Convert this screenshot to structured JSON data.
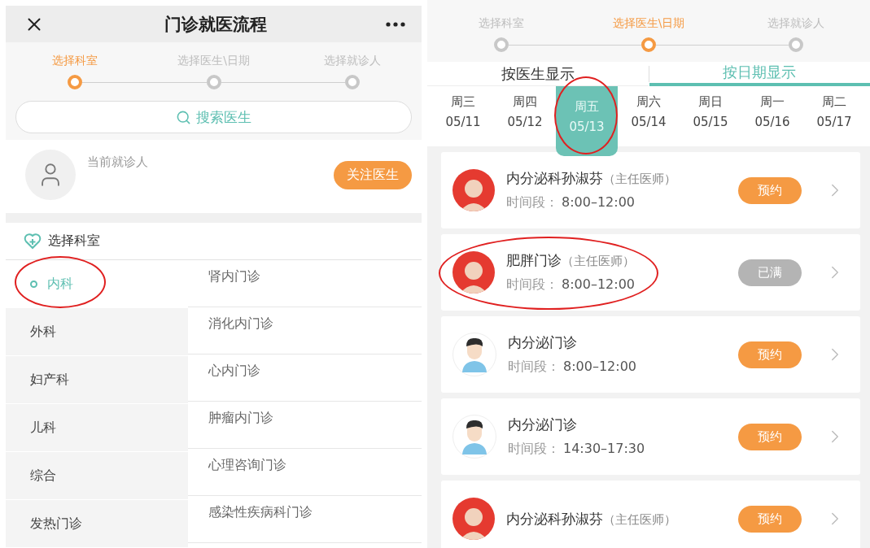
{
  "left": {
    "header": {
      "title": "门诊就医流程"
    },
    "steps": [
      {
        "label": "选择科室",
        "selected": true
      },
      {
        "label": "选择医生\\日期",
        "selected": false
      },
      {
        "label": "选择就诊人",
        "selected": false
      }
    ],
    "search": {
      "placeholder": "搜索医生"
    },
    "patient": {
      "label": "当前就诊人",
      "button": "关注医生"
    },
    "section_title": "选择科室",
    "departments": [
      {
        "label": "内科",
        "selected": true,
        "circled": true
      },
      {
        "label": "外科",
        "selected": false,
        "circled": false
      },
      {
        "label": "妇产科",
        "selected": false,
        "circled": false
      },
      {
        "label": "儿科",
        "selected": false,
        "circled": false
      },
      {
        "label": "综合",
        "selected": false,
        "circled": false
      },
      {
        "label": "发热门诊",
        "selected": false,
        "circled": false
      }
    ],
    "sub_departments": [
      "肾内门诊",
      "消化内门诊",
      "心内门诊",
      "肿瘤内门诊",
      "心理咨询门诊",
      "感染性疾病科门诊"
    ]
  },
  "right": {
    "steps": [
      {
        "label": "选择科室",
        "selected": false
      },
      {
        "label": "选择医生\\日期",
        "selected": true
      },
      {
        "label": "选择就诊人",
        "selected": false
      }
    ],
    "view_tabs": [
      {
        "label": "按医生显示",
        "selected": false
      },
      {
        "label": "按日期显示",
        "selected": true
      }
    ],
    "dates": [
      {
        "weekday": "周三",
        "date": "05/11",
        "selected": false,
        "circled": false
      },
      {
        "weekday": "周四",
        "date": "05/12",
        "selected": false,
        "circled": false
      },
      {
        "weekday": "周五",
        "date": "05/13",
        "selected": true,
        "circled": true
      },
      {
        "weekday": "周六",
        "date": "05/14",
        "selected": false,
        "circled": false
      },
      {
        "weekday": "周日",
        "date": "05/15",
        "selected": false,
        "circled": false
      },
      {
        "weekday": "周一",
        "date": "05/16",
        "selected": false,
        "circled": false
      },
      {
        "weekday": "周二",
        "date": "05/17",
        "selected": false,
        "circled": false
      }
    ],
    "doctors": [
      {
        "name": "内分泌科孙淑芬",
        "title": "（主任医师）",
        "time_label": "时间段：",
        "time": "8:00–12:00",
        "kind": "photo",
        "button": "预约",
        "full": false,
        "circled": false
      },
      {
        "name": "肥胖门诊",
        "title": "（主任医师）",
        "time_label": "时间段：",
        "time": "8:00–12:00",
        "kind": "photo",
        "button": "已满",
        "full": true,
        "circled": true
      },
      {
        "name": "内分泌门诊",
        "time_label": "时间段：",
        "time": "8:00–12:00",
        "kind": "cartoon",
        "button": "预约",
        "full": false,
        "circled": false
      },
      {
        "name": "内分泌门诊",
        "time_label": "时间段：",
        "time": "14:30–17:30",
        "kind": "cartoon",
        "button": "预约",
        "full": false,
        "circled": false
      },
      {
        "name": "内分泌科孙淑芬",
        "title": "（主任医师）",
        "kind": "photo",
        "button": "预约",
        "full": false,
        "circled": false
      }
    ]
  }
}
